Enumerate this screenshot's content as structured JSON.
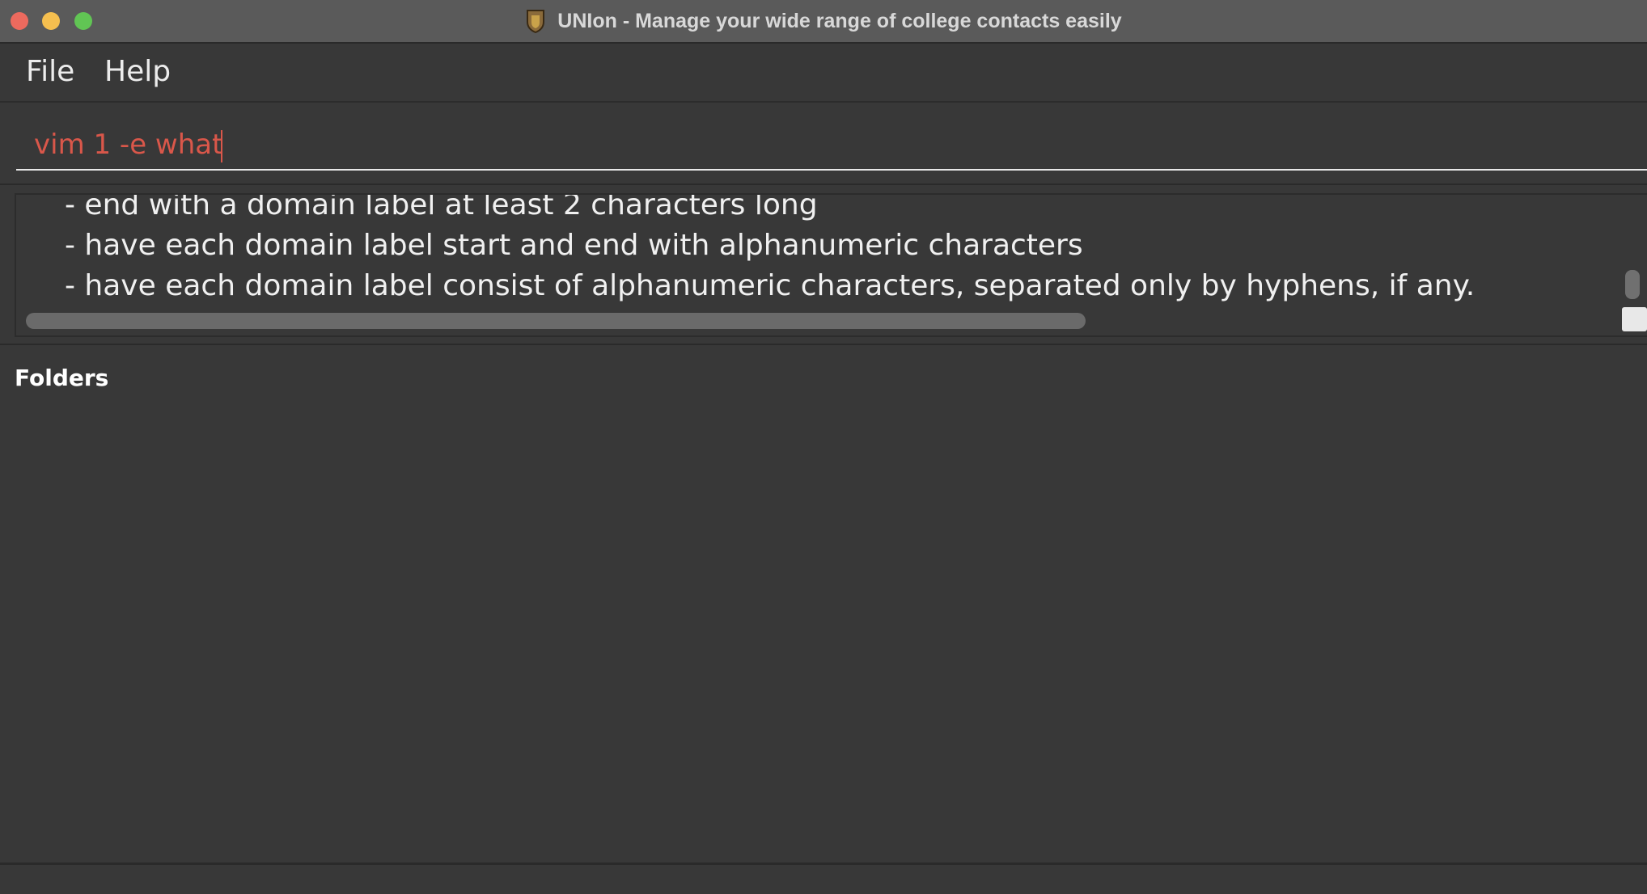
{
  "window": {
    "title": "UNIon - Manage your wide range of college contacts easily",
    "app_icon": "shield-logo-icon"
  },
  "menu": {
    "items": [
      {
        "label": "File"
      },
      {
        "label": "Help"
      }
    ]
  },
  "command_box": {
    "value": "vim 1 -e what",
    "text_color": "#d9574a"
  },
  "result_display": {
    "lines": [
      "- end with a domain label at least 2 characters long",
      "- have each domain label start and end with alphanumeric characters",
      "- have each domain label consist of alphanumeric characters, separated only by hyphens, if any."
    ]
  },
  "folders": {
    "title": "Folders"
  },
  "colors": {
    "background": "#383838",
    "titlebar": "#5a5a5a",
    "error_text": "#d9574a"
  }
}
